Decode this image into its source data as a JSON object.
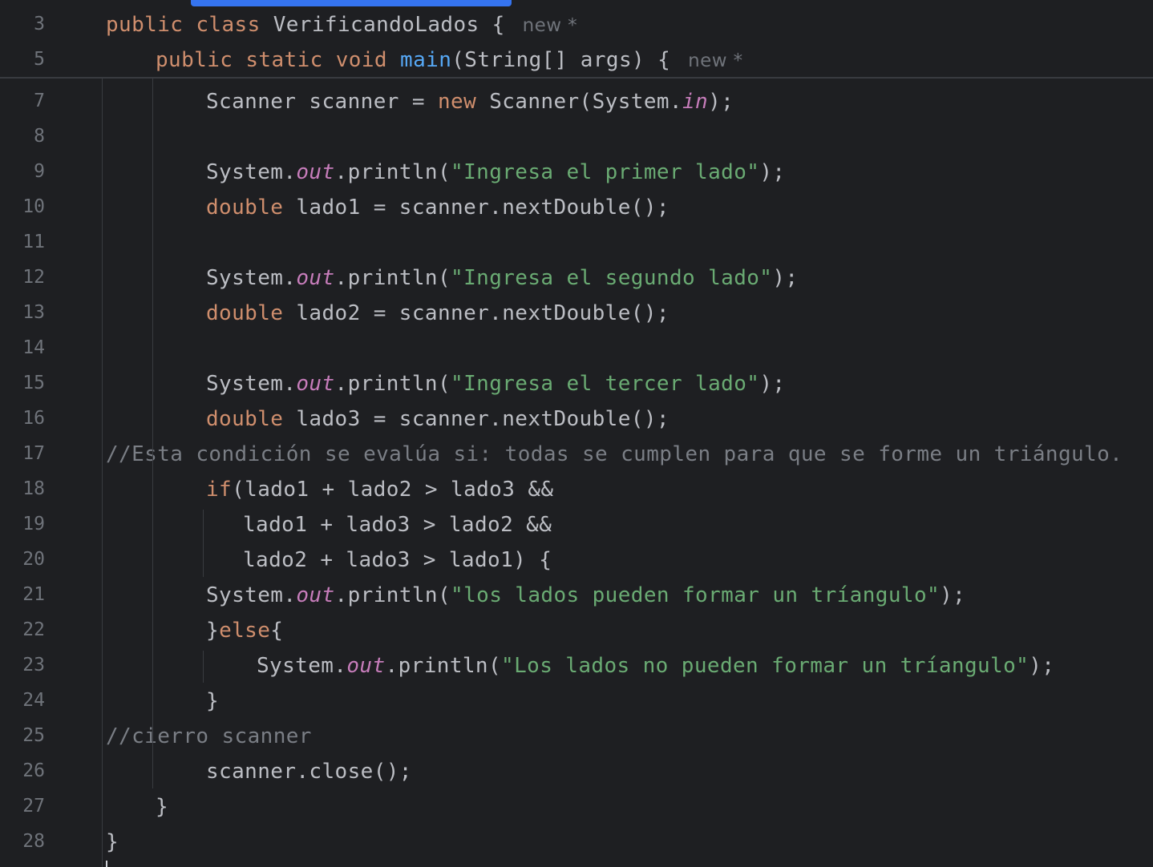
{
  "editor": {
    "sticky": [
      {
        "num": "3",
        "tokens": [
          {
            "t": "public ",
            "c": "kw"
          },
          {
            "t": "class ",
            "c": "kw"
          },
          {
            "t": "VerificandoLados",
            "c": "tx"
          },
          {
            "t": " {",
            "c": "tx"
          }
        ],
        "hint": "new *"
      },
      {
        "num": "5",
        "tokens": [
          {
            "t": "public ",
            "c": "kw"
          },
          {
            "t": "static ",
            "c": "kw"
          },
          {
            "t": "void ",
            "c": "kw"
          },
          {
            "t": "main",
            "c": "fn"
          },
          {
            "t": "(String[] args) {",
            "c": "tx"
          }
        ],
        "hint": "new *"
      }
    ],
    "lines": [
      {
        "num": "7",
        "tokens": [
          {
            "t": "Scanner scanner = ",
            "c": "tx"
          },
          {
            "t": "new ",
            "c": "kw"
          },
          {
            "t": "Scanner(System.",
            "c": "tx"
          },
          {
            "t": "in",
            "c": "fld"
          },
          {
            "t": ");",
            "c": "tx"
          }
        ]
      },
      {
        "num": "8",
        "tokens": []
      },
      {
        "num": "9",
        "tokens": [
          {
            "t": "System.",
            "c": "tx"
          },
          {
            "t": "out",
            "c": "fld"
          },
          {
            "t": ".println(",
            "c": "tx"
          },
          {
            "t": "\"Ingresa el primer lado\"",
            "c": "st"
          },
          {
            "t": ");",
            "c": "tx"
          }
        ]
      },
      {
        "num": "10",
        "tokens": [
          {
            "t": "double ",
            "c": "kw"
          },
          {
            "t": "lado1 = scanner.nextDouble();",
            "c": "tx"
          }
        ]
      },
      {
        "num": "11",
        "tokens": []
      },
      {
        "num": "12",
        "tokens": [
          {
            "t": "System.",
            "c": "tx"
          },
          {
            "t": "out",
            "c": "fld"
          },
          {
            "t": ".println(",
            "c": "tx"
          },
          {
            "t": "\"Ingresa el segundo lado\"",
            "c": "st"
          },
          {
            "t": ");",
            "c": "tx"
          }
        ]
      },
      {
        "num": "13",
        "tokens": [
          {
            "t": "double ",
            "c": "kw"
          },
          {
            "t": "lado2 = scanner.nextDouble();",
            "c": "tx"
          }
        ]
      },
      {
        "num": "14",
        "tokens": []
      },
      {
        "num": "15",
        "tokens": [
          {
            "t": "System.",
            "c": "tx"
          },
          {
            "t": "out",
            "c": "fld"
          },
          {
            "t": ".println(",
            "c": "tx"
          },
          {
            "t": "\"Ingresa el tercer lado\"",
            "c": "st"
          },
          {
            "t": ");",
            "c": "tx"
          }
        ]
      },
      {
        "num": "16",
        "tokens": [
          {
            "t": "double ",
            "c": "kw"
          },
          {
            "t": "lado3 = scanner.nextDouble();",
            "c": "tx"
          }
        ]
      },
      {
        "num": "17",
        "tokens": [
          {
            "t": "//Esta condición se evalúa si: todas se cumplen para que se forme un triángulo.",
            "c": "cm"
          }
        ]
      },
      {
        "num": "18",
        "tokens": [
          {
            "t": "if",
            "c": "kw"
          },
          {
            "t": "(lado1 + lado2 > lado3 &&",
            "c": "tx"
          }
        ]
      },
      {
        "num": "19",
        "tokens": [
          {
            "t": "lado1 + lado3 > lado2 &&",
            "c": "tx"
          }
        ]
      },
      {
        "num": "20",
        "tokens": [
          {
            "t": "lado2 + lado3 > lado1) {",
            "c": "tx"
          }
        ]
      },
      {
        "num": "21",
        "tokens": [
          {
            "t": "System.",
            "c": "tx"
          },
          {
            "t": "out",
            "c": "fld"
          },
          {
            "t": ".println(",
            "c": "tx"
          },
          {
            "t": "\"los lados pueden formar un tríangulo\"",
            "c": "st"
          },
          {
            "t": ");",
            "c": "tx"
          }
        ]
      },
      {
        "num": "22",
        "tokens": [
          {
            "t": "}",
            "c": "tx"
          },
          {
            "t": "else",
            "c": "kw"
          },
          {
            "t": "{",
            "c": "tx"
          }
        ]
      },
      {
        "num": "23",
        "tokens": [
          {
            "t": "System.",
            "c": "tx"
          },
          {
            "t": "out",
            "c": "fld"
          },
          {
            "t": ".println(",
            "c": "tx"
          },
          {
            "t": "\"Los lados no pueden formar un tríangulo\"",
            "c": "st"
          },
          {
            "t": ");",
            "c": "tx"
          }
        ]
      },
      {
        "num": "24",
        "tokens": [
          {
            "t": "}",
            "c": "tx"
          }
        ]
      },
      {
        "num": "25",
        "tokens": [
          {
            "t": "//cierro scanner",
            "c": "cm"
          }
        ]
      },
      {
        "num": "26",
        "tokens": [
          {
            "t": "scanner.close();",
            "c": "tx"
          }
        ]
      },
      {
        "num": "27",
        "tokens": [
          {
            "t": "}",
            "c": "tx"
          }
        ]
      },
      {
        "num": "28",
        "tokens": [
          {
            "t": "}",
            "c": "tx"
          }
        ]
      }
    ]
  },
  "theme": {
    "background": "#1e1f22",
    "keyword": "#cf8e6d",
    "function": "#56a8f5",
    "string": "#6aab73",
    "field": "#c77dbb",
    "comment": "#7a7e85",
    "text": "#bcbec4",
    "line_number": "#6f737a",
    "scrollbar": "#3574f0"
  }
}
